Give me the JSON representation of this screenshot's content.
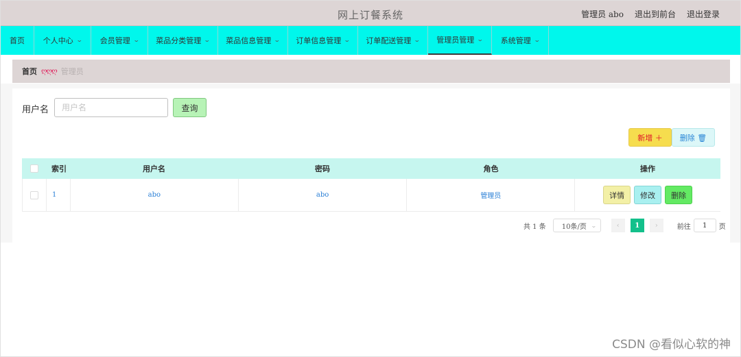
{
  "header": {
    "title": "网上订餐系统",
    "user_label": "管理员 abo",
    "front_link": "退出到前台",
    "logout_link": "退出登录"
  },
  "nav": {
    "items": [
      {
        "label": "首页",
        "has_dropdown": false
      },
      {
        "label": "个人中心",
        "has_dropdown": true
      },
      {
        "label": "会员管理",
        "has_dropdown": true
      },
      {
        "label": "菜品分类管理",
        "has_dropdown": true
      },
      {
        "label": "菜品信息管理",
        "has_dropdown": true
      },
      {
        "label": "订单信息管理",
        "has_dropdown": true
      },
      {
        "label": "订单配送管理",
        "has_dropdown": true
      },
      {
        "label": "管理员管理",
        "has_dropdown": true,
        "active": true
      },
      {
        "label": "系统管理",
        "has_dropdown": true
      }
    ]
  },
  "breadcrumb": {
    "home": "首页",
    "separator": "ღღღ",
    "current": "管理员"
  },
  "search": {
    "label": "用户名",
    "placeholder": "用户名",
    "value": "",
    "query_button": "查询"
  },
  "toolbar": {
    "add_label": "新增 ＋",
    "delete_label": "删除 🗑"
  },
  "table": {
    "columns": [
      "",
      "索引",
      "用户名",
      "密码",
      "角色",
      "操作"
    ],
    "rows": [
      {
        "index": "1",
        "username": "abo",
        "password": "abo",
        "role": "管理员"
      }
    ],
    "row_actions": {
      "detail": "详情",
      "edit": "修改",
      "delete": "删除"
    }
  },
  "pagination": {
    "total": "共 1 条",
    "page_size": "10条/页",
    "prev": "‹",
    "current_page": "1",
    "next": "›",
    "goto_label": "前往",
    "goto_value": "1",
    "page_suffix": "页"
  },
  "watermark": "CSDN @看似心软的神",
  "colors": {
    "header_bg": "#ddd5d5",
    "nav_bg": "#00f7ec",
    "table_header_bg": "#c6f6ef",
    "query_btn": "#b7f3b6",
    "add_btn": "#f6dd4e",
    "pager_active": "#13c08b"
  }
}
